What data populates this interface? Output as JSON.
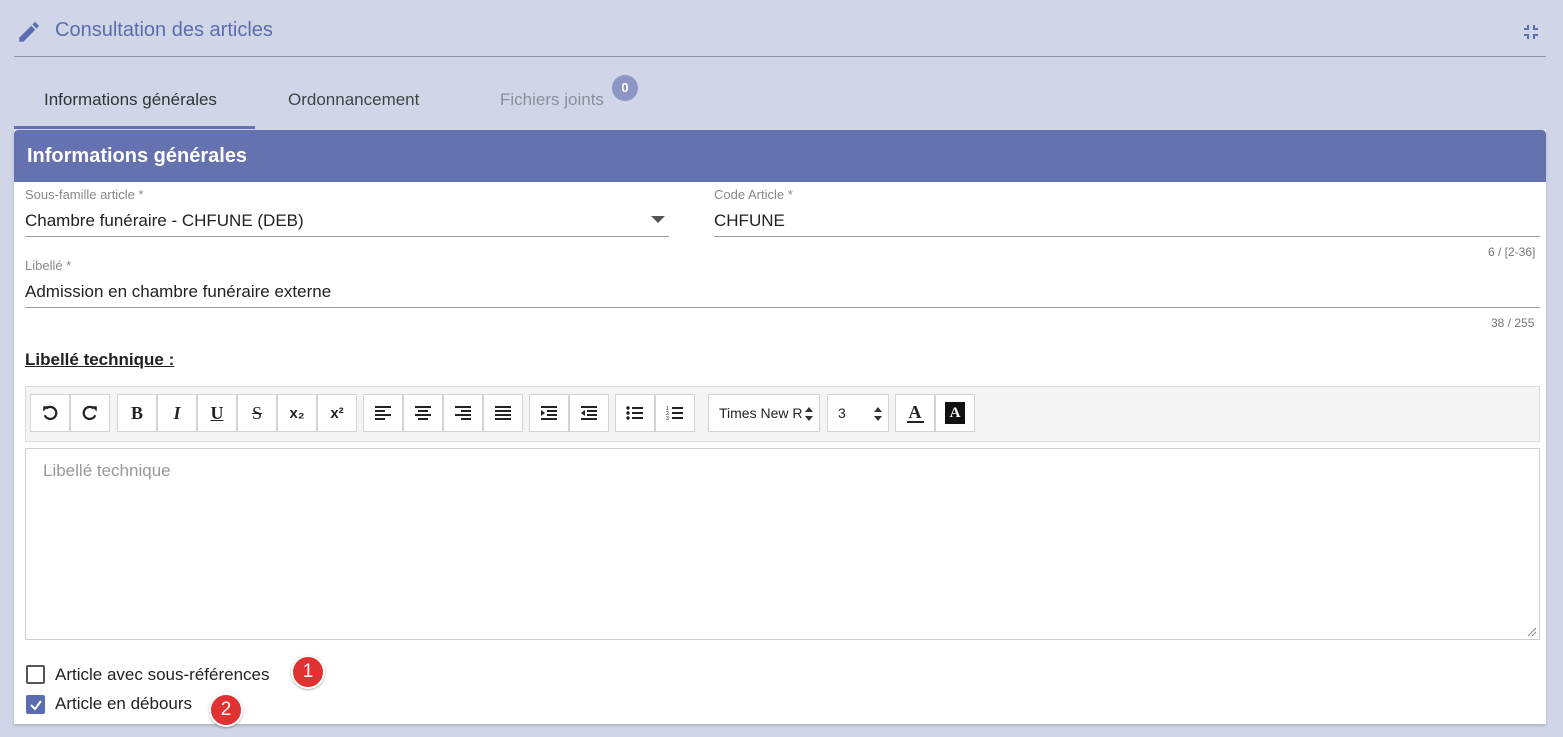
{
  "header": {
    "title": "Consultation des articles"
  },
  "tabs": [
    {
      "label": "Informations générales"
    },
    {
      "label": "Ordonnancement"
    },
    {
      "label": "Fichiers joints",
      "count": "0"
    }
  ],
  "card": {
    "title": "Informations générales",
    "sous_famille": {
      "label": "Sous-famille article *",
      "value": "Chambre funéraire - CHFUNE (DEB)"
    },
    "code_article": {
      "label": "Code Article *",
      "value": "CHFUNE",
      "counter": "6 / [2-36]"
    },
    "libelle": {
      "label": "Libellé *",
      "value": "Admission en chambre funéraire externe",
      "counter": "38 / 255"
    },
    "libelle_technique": {
      "title": "Libellé technique :",
      "placeholder": "Libellé technique",
      "font_select": "Times New R",
      "size_select": "3"
    },
    "checkboxes": [
      {
        "label": "Article avec sous-références",
        "checked": false,
        "annotation": "1"
      },
      {
        "label": "Article en débours",
        "checked": true,
        "annotation": "2"
      }
    ]
  },
  "colors": {
    "accent": "#6472b0",
    "annotation": "#e03232",
    "background": "#d0d6e7"
  },
  "icons": [
    "pencil-icon",
    "collapse-icon",
    "undo-icon",
    "redo-icon",
    "bold-icon",
    "italic-icon",
    "underline-icon",
    "strikethrough-icon",
    "subscript-icon",
    "superscript-icon",
    "align-left-icon",
    "align-center-icon",
    "align-right-icon",
    "align-justify-icon",
    "indent-icon",
    "outdent-icon",
    "bullet-list-icon",
    "numbered-list-icon",
    "text-color-icon",
    "background-color-icon",
    "dropdown-arrow-icon",
    "checkmark-icon"
  ]
}
